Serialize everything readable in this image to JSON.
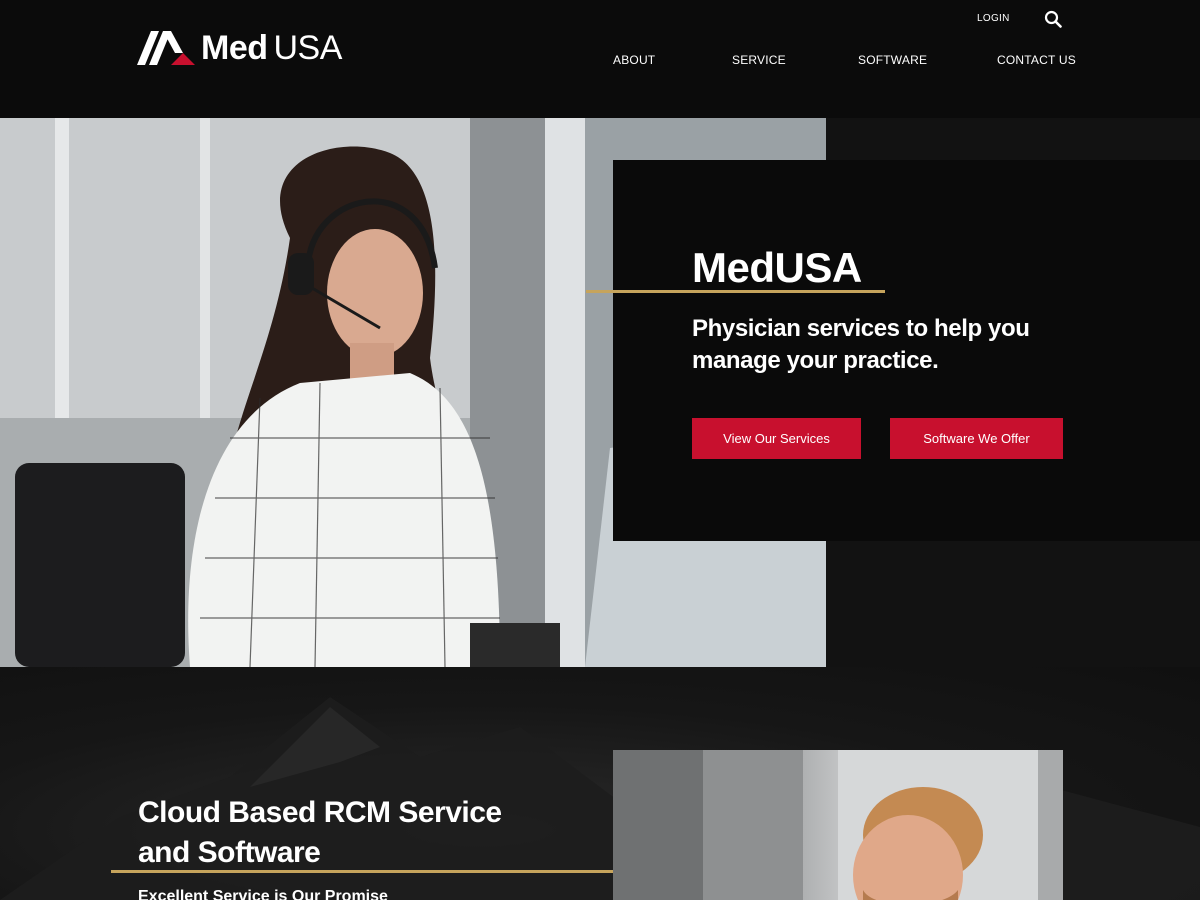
{
  "header": {
    "logo": {
      "text_bold": "Med",
      "text_light": "USA"
    },
    "login_label": "LOGIN",
    "search_icon": "search-icon",
    "nav": [
      "ABOUT",
      "SERVICE",
      "SOFTWARE",
      "CONTACT US"
    ]
  },
  "hero": {
    "title": "MedUSA",
    "subtitle": "Physician services to help you manage your practice.",
    "buttons": [
      "View Our Services",
      "Software We Offer"
    ],
    "photo": "woman-with-headset-at-computer"
  },
  "section2": {
    "title": "Cloud Based RCM Service and Software",
    "subtitle": "Excellent Service is Our Promise",
    "photo": "smiling-man-photo"
  },
  "colors": {
    "background": "#0b0b0b",
    "accent_red": "#c8102e",
    "accent_gold": "#c6a45c",
    "text": "#ffffff"
  }
}
